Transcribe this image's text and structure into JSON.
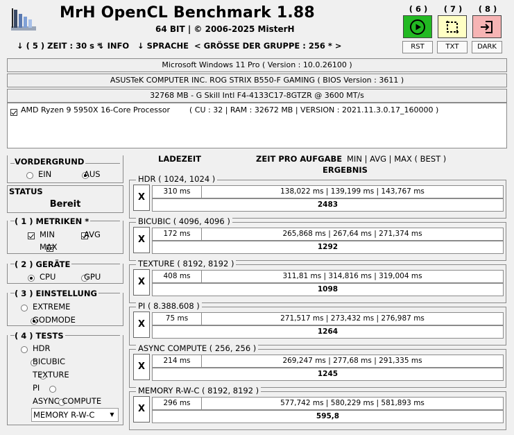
{
  "app": {
    "title": "MrH OpenCL Benchmark 1.88",
    "subtitle": "64 BIT | ©  2006-2025 MisterH"
  },
  "menu": {
    "zeit": "↓ ( 5 ) ZEIT : 30 s *",
    "info": "↓ INFO",
    "sprache": "↓ SPRACHE",
    "gruppe": "< GRÖSSE DER GRUPPE : 256 * >"
  },
  "toolbar": [
    {
      "num": "( 6 )",
      "label": "RST",
      "icon": "play-icon",
      "color": "#22b922"
    },
    {
      "num": "( 7 )",
      "label": "TXT",
      "icon": "crop-icon",
      "color": "#ffffc4"
    },
    {
      "num": "( 8 )",
      "label": "DARK",
      "icon": "login-icon",
      "color": "#f6b4b4"
    }
  ],
  "system": {
    "os": "Microsoft Windows 11 Pro ( Version : 10.0.26100 )",
    "board": "ASUSTeK COMPUTER INC. ROG STRIX B550-F GAMING ( BIOS Version : 3611 )",
    "memory": "32768 MB - G Skill Intl F4-4133C17-8GTZR @ 3600 MT/s",
    "cpu_name": "AMD Ryzen 9 5950X 16-Core Processor",
    "cpu_info": "( CU : 32 | RAM : 32672 MB | VERSION : 2021.11.3.0.17_160000 )",
    "cpu_checked": true
  },
  "left": {
    "vordergrund": {
      "title": "VORDERGRUND",
      "ein": "EIN",
      "aus": "AUS",
      "selected": "aus"
    },
    "status": {
      "title": "STATUS",
      "value": "Bereit"
    },
    "metriken": {
      "title": "( 1 ) METRIKEN *",
      "min": "MIN",
      "avg": "AVG",
      "max": "MAX",
      "min_on": true,
      "avg_on": true,
      "max_on": true
    },
    "geraete": {
      "title": "( 2 ) GERÄTE",
      "cpu": "CPU",
      "gpu": "GPU",
      "selected": "cpu"
    },
    "einstellung": {
      "title": "( 3 ) EINSTELLUNG",
      "extreme": "EXTREME",
      "godmode": "GODMODE",
      "selected": "godmode"
    },
    "tests": {
      "title": "( 4 ) TESTS",
      "items": [
        "HDR",
        "BICUBIC",
        "TEXTURE",
        "PI",
        "ASYNC COMPUTE"
      ],
      "selected_combo": "MEMORY R-W-C"
    }
  },
  "headers": {
    "ladezeit": "LADEZEIT",
    "zeit_pro_aufgabe": "ZEIT PRO AUFGABE",
    "min_avg_max": "MIN | AVG | MAX ( BEST )",
    "ergebnis": "ERGEBNIS"
  },
  "tests": [
    {
      "name": "HDR ( 1024, 1024 )",
      "x": "X",
      "load": "310 ms",
      "times": "138,022 ms | 139,199 ms | 143,767 ms",
      "result": "2483"
    },
    {
      "name": "BICUBIC ( 4096, 4096 )",
      "x": "X",
      "load": "172 ms",
      "times": "265,868 ms | 267,64 ms | 271,374 ms",
      "result": "1292"
    },
    {
      "name": "TEXTURE ( 8192, 8192 )",
      "x": "X",
      "load": "408 ms",
      "times": "311,81 ms | 314,816 ms | 319,004 ms",
      "result": "1098"
    },
    {
      "name": "PI ( 8.388.608 )",
      "x": "X",
      "load": "75 ms",
      "times": "271,517 ms | 273,432 ms | 276,987 ms",
      "result": "1264"
    },
    {
      "name": "ASYNC COMPUTE ( 256, 256 )",
      "x": "X",
      "load": "214 ms",
      "times": "269,247 ms | 277,68 ms | 291,335 ms",
      "result": "1245"
    },
    {
      "name": "MEMORY R-W-C ( 8192, 8192 )",
      "x": "X",
      "load": "296 ms",
      "times": "577,742 ms | 580,229 ms | 581,893 ms",
      "result": "595,8"
    }
  ]
}
